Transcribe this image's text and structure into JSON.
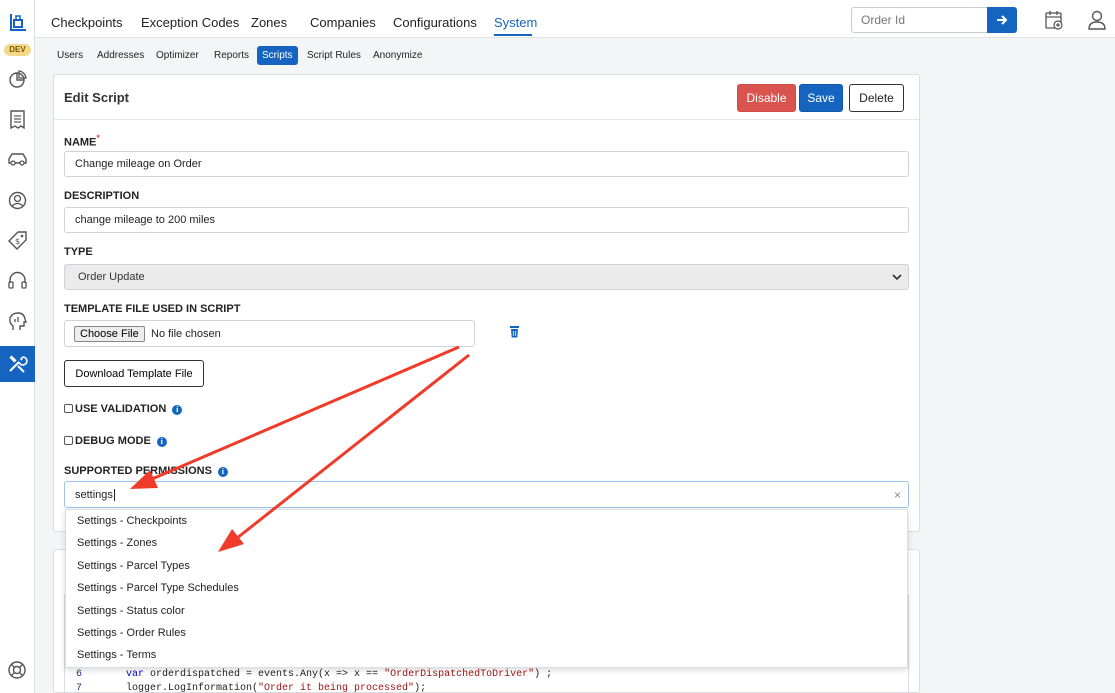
{
  "env_badge": "DEV",
  "nav": {
    "tabs": [
      "Checkpoints",
      "Exception Codes",
      "Zones",
      "Companies",
      "Configurations",
      "System"
    ],
    "selected": "System",
    "order_id_placeholder": "Order Id"
  },
  "subnav": {
    "items": [
      "Users",
      "Addresses",
      "Optimizer",
      "Reports",
      "Scripts",
      "Script Rules",
      "Anonymize"
    ],
    "selected": "Scripts"
  },
  "form": {
    "title": "Edit Script",
    "buttons": {
      "disable": "Disable",
      "save": "Save",
      "delete": "Delete"
    },
    "name_label": "NAME",
    "required_mark": "*",
    "name_value": "Change mileage on Order",
    "description_label": "DESCRIPTION",
    "description_value": "change mileage to 200 miles",
    "type_label": "TYPE",
    "type_value": "Order Update",
    "template_label": "TEMPLATE FILE USED IN SCRIPT",
    "choose_file": "Choose File",
    "no_file": "No file chosen",
    "download_template": "Download Template File",
    "use_validation": "USE VALIDATION",
    "debug_mode": "DEBUG MODE",
    "permissions_label": "SUPPORTED PERMISSIONS",
    "permissions_search": "settings",
    "clear_symbol": "×"
  },
  "dropdown_options": [
    "Settings - Checkpoints",
    "Settings - Zones",
    "Settings - Parcel Types",
    "Settings - Parcel Type Schedules",
    "Settings - Status color",
    "Settings - Order Rules",
    "Settings - Terms"
  ],
  "code": {
    "line6_no": "6",
    "line6_kw": "var",
    "line6_a": " orderdispatched = events.Any(x => x == ",
    "line6_str": "\"OrderDispatchedToDriver\"",
    "line6_b": ") ;",
    "line7_no": "7",
    "line7_a": "logger.LogInformation(",
    "line7_str": "\"Order it being processed\"",
    "line7_b": ");"
  },
  "colors": {
    "accent": "#1565c0",
    "danger": "#d9534f",
    "arrow": "#f03a2a"
  },
  "icons": [
    "logo-icon",
    "chart-icon",
    "receipt-icon",
    "car-icon",
    "user-circle-icon",
    "tag-dollar-icon",
    "headset-icon",
    "analytics-head-icon",
    "tools-icon",
    "lifebuoy-icon",
    "arrow-right-icon",
    "calendar-add-icon",
    "user-icon",
    "trash-icon",
    "info-icon"
  ]
}
